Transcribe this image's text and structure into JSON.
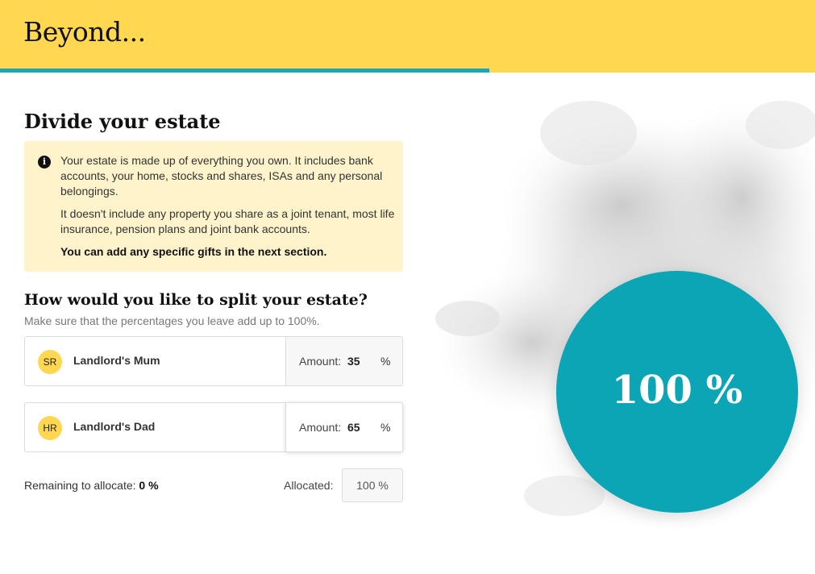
{
  "header": {
    "logo": "Beyond..."
  },
  "progress": {
    "completed_fraction": 0.6
  },
  "page": {
    "title": "Divide your estate"
  },
  "info": {
    "paragraph_1": "Your estate is made up of everything you own. It includes bank accounts, your home, stocks and shares, ISAs and any personal belongings.",
    "paragraph_2": "It doesn't include any property you share as a joint tenant, most life insurance, pension plans and joint bank accounts.",
    "paragraph_3": "You can add any specific gifts in the next section."
  },
  "split": {
    "title": "How would you like to split your estate?",
    "hint": "Make sure that the percentages you leave add up to 100%."
  },
  "beneficiaries": [
    {
      "initials": "SR",
      "name": "Landlord's Mum",
      "amount_label": "Amount:",
      "amount": "35",
      "unit": "%"
    },
    {
      "initials": "HR",
      "name": "Landlord's Dad",
      "amount_label": "Amount:",
      "amount": "65",
      "unit": "%"
    }
  ],
  "summary": {
    "remaining_label": "Remaining to allocate:",
    "remaining_value": "0 %",
    "allocated_label": "Allocated:",
    "allocated_value": "100 %"
  },
  "total": {
    "display": "100 %"
  },
  "colors": {
    "brand_yellow": "#ffd750",
    "accent_teal": "#0ba5b5",
    "info_bg": "#fff3cc"
  }
}
